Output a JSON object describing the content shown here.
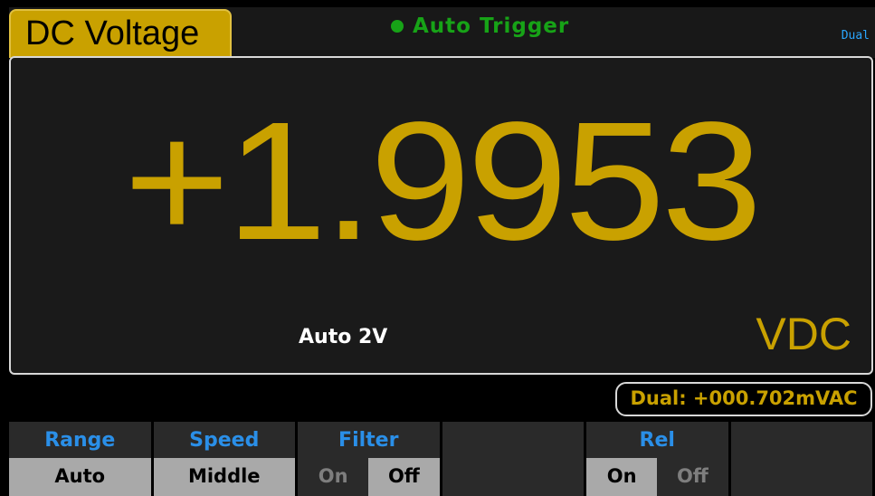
{
  "header": {
    "function_name": "DC Voltage",
    "trigger_label": "Auto  Trigger",
    "trigger_color": "#17a317",
    "dual_tag": "Dual"
  },
  "display": {
    "reading": "+1.9953",
    "range": "Auto  2V",
    "unit": "VDC",
    "reading_color": "#c9a100"
  },
  "dual_readout": {
    "text": "Dual: +000.702mVAC"
  },
  "softkeys": [
    {
      "label": "Range",
      "value": "Auto"
    },
    {
      "label": "Speed",
      "value": "Middle"
    },
    {
      "label": "Filter",
      "options": [
        "On",
        "Off"
      ],
      "active": "Off"
    },
    {
      "label": "",
      "value": ""
    },
    {
      "label": "Rel",
      "options": [
        "On",
        "Off"
      ],
      "active": "On"
    },
    {
      "label": "",
      "value": ""
    }
  ],
  "colors": {
    "accent": "#c9a100",
    "softkey_label": "#2a8fe8",
    "dual_tag": "#2aa6ff"
  }
}
